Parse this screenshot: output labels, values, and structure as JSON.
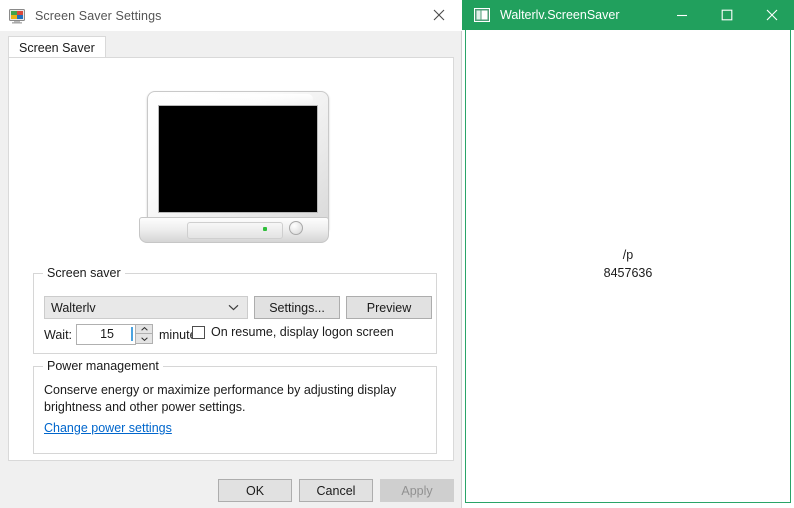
{
  "dialog": {
    "title": "Screen Saver Settings",
    "icon": "monitor-icon",
    "close_icon": "close-icon",
    "tabs": [
      {
        "label": "Screen Saver",
        "selected": true
      }
    ],
    "preview": {
      "icon": "monitor-preview",
      "screen_color": "#000000",
      "led_color": "#2fbe3a"
    },
    "screen_saver_group": {
      "legend": "Screen saver",
      "combo": {
        "value": "Walterlv",
        "chevron_icon": "chevron-down-icon"
      },
      "settings_button": "Settings...",
      "preview_button": "Preview",
      "wait_label": "Wait:",
      "wait_value": "15",
      "minutes_label": "minutes",
      "resume_checkbox": {
        "label": "On resume, display logon screen",
        "checked": false
      },
      "spinner_up_icon": "spinner-up-icon",
      "spinner_down_icon": "spinner-down-icon"
    },
    "power_group": {
      "legend": "Power management",
      "description": "Conserve energy or maximize performance by adjusting display brightness and other power settings.",
      "link": "Change power settings",
      "link_color": "#0066cc"
    },
    "footer": {
      "ok": "OK",
      "cancel": "Cancel",
      "apply": "Apply",
      "apply_disabled": true
    }
  },
  "saver_window": {
    "title": "Walterlv.ScreenSaver",
    "icon": "window-app-icon",
    "titlebar_color": "#21a05d",
    "minimize_icon": "minimize-icon",
    "maximize_icon": "maximize-icon",
    "close_icon": "close-icon",
    "content": {
      "line1": "/p",
      "line2": "8457636"
    }
  }
}
